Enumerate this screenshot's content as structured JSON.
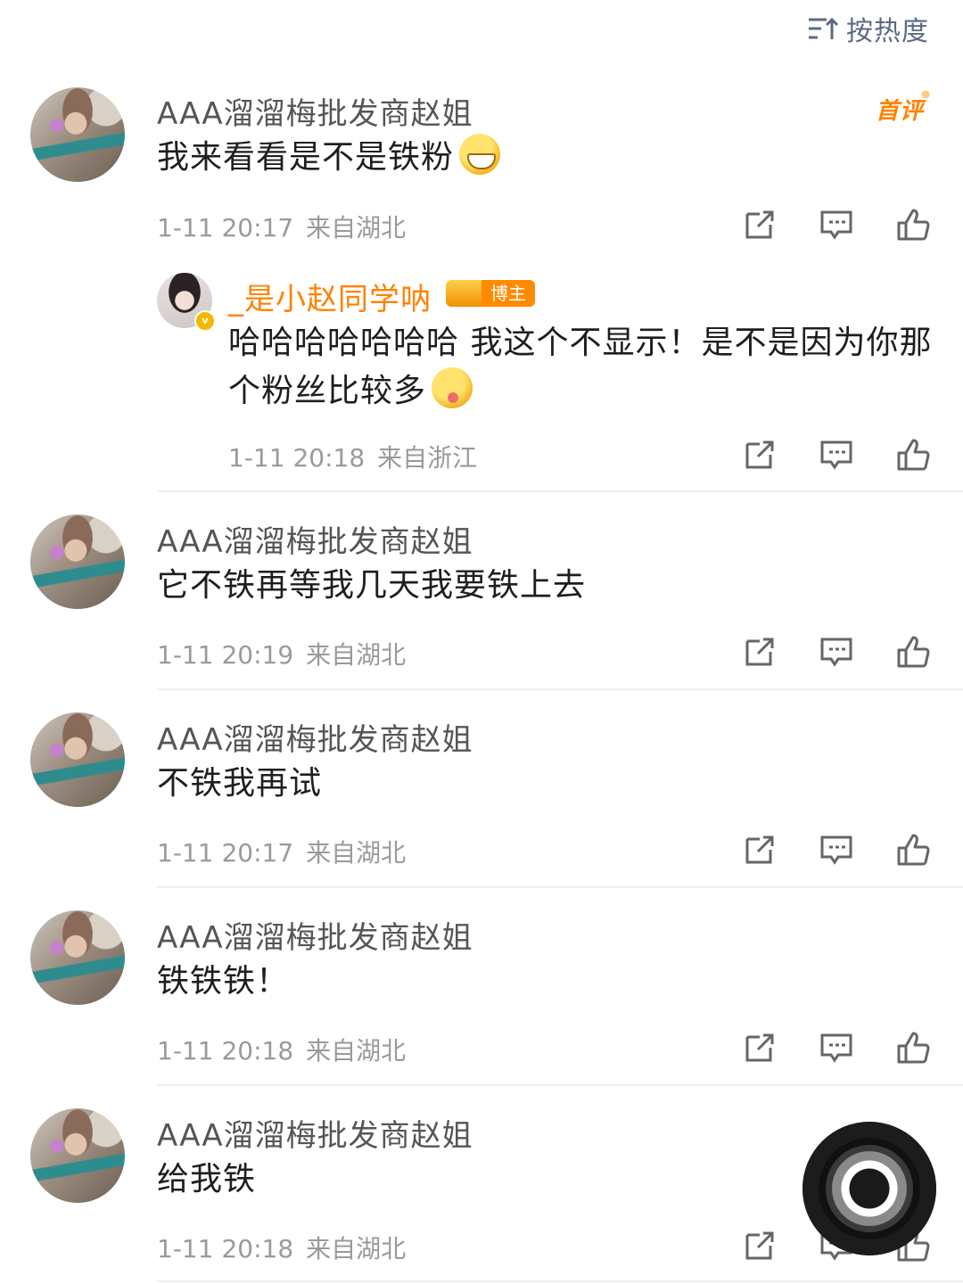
{
  "sort": {
    "label": "按热度",
    "icon": "sort-icon"
  },
  "first_comment_badge": "首评",
  "comments": [
    {
      "user": "AAA溜溜梅批发商赵姐",
      "text": "我来看看是不是铁粉",
      "time": "1-11 20:17",
      "location": "来自湖北"
    },
    {
      "user": "AAA溜溜梅批发商赵姐",
      "text": "它不铁再等我几天我要铁上去",
      "time": "1-11 20:19",
      "location": "来自湖北"
    },
    {
      "user": "AAA溜溜梅批发商赵姐",
      "text": "不铁我再试",
      "time": "1-11 20:17",
      "location": "来自湖北"
    },
    {
      "user": "AAA溜溜梅批发商赵姐",
      "text": "铁铁铁！",
      "time": "1-11 20:18",
      "location": "来自湖北"
    },
    {
      "user": "AAA溜溜梅批发商赵姐",
      "text": "给我铁",
      "time": "1-11 20:18",
      "location": "来自湖北"
    }
  ],
  "reply": {
    "user": "_是小赵同学呐",
    "tag": "博主",
    "verified_badge": "v",
    "text": "哈哈哈哈哈哈哈 我这个不显示！是不是因为你那个粉丝比较多",
    "time": "1-11 20:18",
    "location": "来自浙江"
  },
  "colors": {
    "accent": "#ff8200",
    "sort": "#5b6a85",
    "meta": "#9a9a9a"
  }
}
